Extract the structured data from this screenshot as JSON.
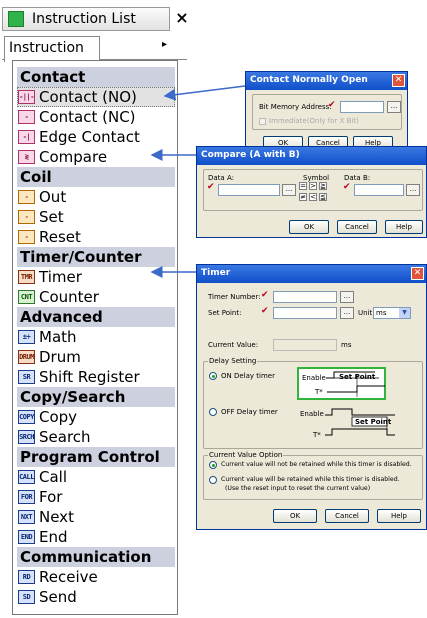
{
  "panel": {
    "title": "Instruction List",
    "close": "×",
    "tab": "Instruction",
    "tab_arrow": "▸",
    "groups": [
      {
        "label": "Contact",
        "items": [
          {
            "label": "Contact (NO)",
            "icon": "contact-no-icon",
            "glyph": "-||-",
            "style": "pink",
            "selected": true
          },
          {
            "label": "Contact (NC)",
            "icon": "contact-nc-icon",
            "glyph": "-|/|-",
            "style": "pink"
          },
          {
            "label": "Edge Contact",
            "icon": "edge-contact-icon",
            "glyph": "-|↑|-",
            "style": "pink"
          },
          {
            "label": "Compare",
            "icon": "compare-icon",
            "glyph": "≷",
            "style": "pink"
          }
        ]
      },
      {
        "label": "Coil",
        "items": [
          {
            "label": "Out",
            "icon": "coil-out-icon",
            "glyph": "-(OUT)",
            "style": "orange"
          },
          {
            "label": "Set",
            "icon": "coil-set-icon",
            "glyph": "-(SET)",
            "style": "orange"
          },
          {
            "label": "Reset",
            "icon": "coil-reset-icon",
            "glyph": "-(RST)",
            "style": "orange"
          }
        ]
      },
      {
        "label": "Timer/Counter",
        "items": [
          {
            "label": "Timer",
            "icon": "timer-icon",
            "glyph": "TMR",
            "style": ""
          },
          {
            "label": "Counter",
            "icon": "counter-icon",
            "glyph": "CNT",
            "style": "green"
          }
        ]
      },
      {
        "label": "Advanced",
        "items": [
          {
            "label": "Math",
            "icon": "math-icon",
            "glyph": "±÷",
            "style": "blue"
          },
          {
            "label": "Drum",
            "icon": "drum-icon",
            "glyph": "DRUM",
            "style": ""
          },
          {
            "label": "Shift Register",
            "icon": "shift-register-icon",
            "glyph": "SR",
            "style": "blue"
          }
        ]
      },
      {
        "label": "Copy/Search",
        "items": [
          {
            "label": "Copy",
            "icon": "copy-icon",
            "glyph": "COPY",
            "style": "blue"
          },
          {
            "label": "Search",
            "icon": "search-icon",
            "glyph": "SRCH",
            "style": "blue"
          }
        ]
      },
      {
        "label": "Program Control",
        "items": [
          {
            "label": "Call",
            "icon": "call-icon",
            "glyph": "CALL",
            "style": "blue"
          },
          {
            "label": "For",
            "icon": "for-icon",
            "glyph": "FOR",
            "style": "blue"
          },
          {
            "label": "Next",
            "icon": "next-icon",
            "glyph": "NXT",
            "style": "blue"
          },
          {
            "label": "End",
            "icon": "end-icon",
            "glyph": "END",
            "style": "blue"
          }
        ]
      },
      {
        "label": "Communication",
        "items": [
          {
            "label": "Receive",
            "icon": "receive-icon",
            "glyph": "RD",
            "style": "blue"
          },
          {
            "label": "Send",
            "icon": "send-icon",
            "glyph": "SD",
            "style": "blue"
          }
        ]
      }
    ]
  },
  "dialog_contact": {
    "title": "Contact Normally Open",
    "close": "✕",
    "bit_memory_label": "Bit Memory Address:",
    "immediate_label": "Immediate(Only for X Bit)",
    "ellipsis": "...",
    "ok": "OK",
    "cancel": "Cancel",
    "help": "Help"
  },
  "dialog_compare": {
    "title": "Compare (A with B)",
    "data_a_label": "Data A:",
    "symbol_label": "Symbol",
    "data_b_label": "Data B:",
    "symbols": [
      "=",
      ">",
      "≧",
      "≠",
      "<",
      "≦"
    ],
    "ellipsis": "...",
    "ok": "OK",
    "cancel": "Cancel",
    "help": "Help"
  },
  "dialog_timer": {
    "title": "Timer",
    "close": "✕",
    "timer_number_label": "Timer Number:",
    "set_point_label": "Set Point:",
    "unit_label": "Unit",
    "unit_value": "ms",
    "current_value_label": "Current Value:",
    "current_value_unit": "ms",
    "delay_setting_label": "Delay Setting",
    "on_delay_label": "ON Delay timer",
    "off_delay_label": "OFF Delay timer",
    "enable_label": "Enable",
    "t_label": "T*",
    "set_point_diagram": "Set Point",
    "current_value_option_label": "Current Value Option",
    "option1": "Current value will not be retained while this timer is disabled.",
    "option2a": "Current value will be retained while this timer is disabled.",
    "option2b": "(Use the reset input to reset the current value)",
    "ellipsis": "...",
    "ok": "OK",
    "cancel": "Cancel",
    "help": "Help"
  }
}
